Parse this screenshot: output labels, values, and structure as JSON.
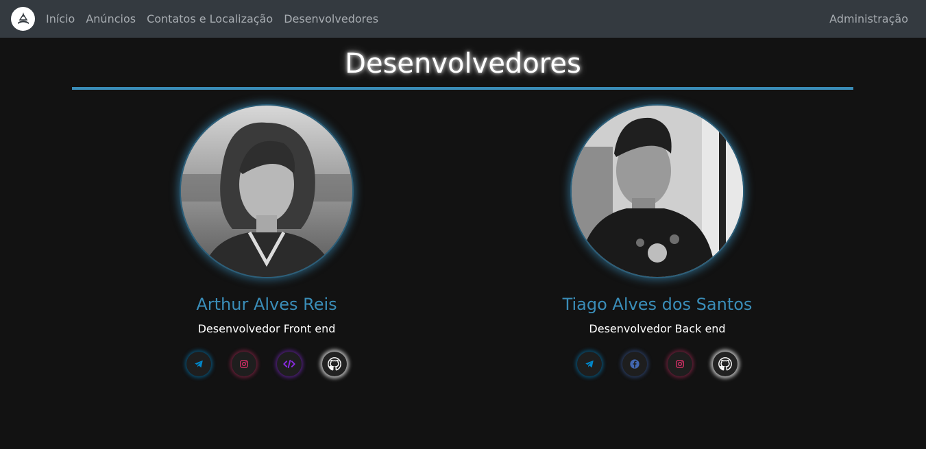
{
  "nav": {
    "links": [
      "Início",
      "Anúncios",
      "Contatos e Localização",
      "Desenvolvedores"
    ],
    "admin": "Administração"
  },
  "page": {
    "title": "Desenvolvedores"
  },
  "developers": [
    {
      "name": "Arthur Alves Reis",
      "role": "Desenvolvedor Front end",
      "socials": [
        "telegram-icon",
        "instagram-icon",
        "code-icon",
        "github-icon"
      ]
    },
    {
      "name": "Tiago Alves dos Santos",
      "role": "Desenvolvedor Back end",
      "socials": [
        "telegram-icon",
        "facebook-icon",
        "instagram-icon",
        "github-icon"
      ]
    }
  ],
  "colors": {
    "navbar": "#343a40",
    "background": "#121212",
    "accent": "#3a8db8",
    "telegram": "#0088cc",
    "instagram": "#e1306c",
    "code": "#8a2be2",
    "facebook": "#4267b2"
  }
}
